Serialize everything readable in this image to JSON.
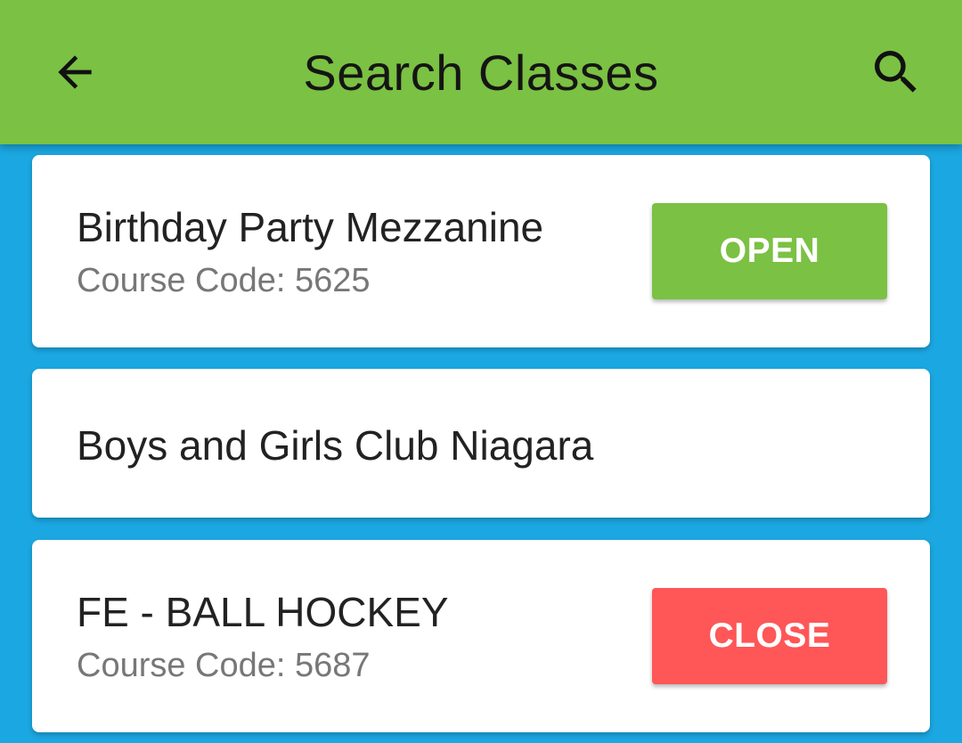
{
  "colors": {
    "app_bar": "#7bc143",
    "background": "#1ba7e1",
    "open": "#7bc143",
    "close": "#ff5657"
  },
  "header": {
    "title": "Search Classes",
    "back_icon": "arrow-back-icon",
    "search_icon": "search-icon"
  },
  "classes": [
    {
      "name": "Birthday Party Mezzanine",
      "code": "Course Code: 5625",
      "status": "OPEN"
    },
    {
      "name": "Boys and Girls Club Niagara"
    },
    {
      "name": "FE - BALL HOCKEY",
      "code": "Course Code: 5687",
      "status": "CLOSE"
    }
  ]
}
